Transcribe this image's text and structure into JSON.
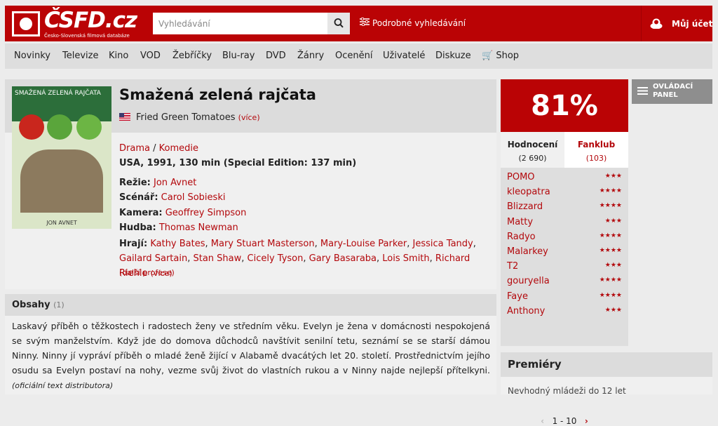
{
  "header": {
    "logo_text": "ČSFD.cz",
    "logo_tagline": "Česko-Slovenská filmová databáze",
    "search_placeholder": "Vyhledávání",
    "advanced_search": "Podrobné vyhledávání",
    "account": "Můj účet"
  },
  "nav": {
    "items": [
      "Novinky",
      "Televize",
      "Kino",
      "VOD",
      "Žebříčky",
      "Blu-ray",
      "DVD",
      "Žánry",
      "Ocenění",
      "Uživatelé",
      "Diskuze",
      "Shop"
    ]
  },
  "poster": {
    "title": "SMAŽENÁ ZELENÁ RAJČATA",
    "director": "JON AVNET"
  },
  "film": {
    "title": "Smažená zelená rajčata",
    "original_title": "Fried Green Tomatoes",
    "more": "(více)",
    "genres": [
      "Drama",
      "Komedie"
    ],
    "genre_sep": " / ",
    "origin": "USA, 1991, 130 min (Special Edition: 137 min)",
    "crew": [
      {
        "role": "Režie:",
        "name": "Jon Avnet"
      },
      {
        "role": "Scénář:",
        "name": "Carol Sobieski"
      },
      {
        "role": "Kamera:",
        "name": "Geoffrey Simpson"
      },
      {
        "role": "Hudba:",
        "name": "Thomas Newman"
      }
    ],
    "cast_label": "Hrají:",
    "cast": [
      "Kathy Bates",
      "Mary Stuart Masterson",
      "Mary-Louise Parker",
      "Jessica Tandy",
      "Gailard Sartain",
      "Stan Shaw",
      "Cicely Tyson",
      "Gary Basaraba",
      "Lois Smith",
      "Richard Riehle"
    ],
    "cast_more": "(více)",
    "more_professions": "(další profese)"
  },
  "plots": {
    "title": "Obsahy",
    "count": "(1)",
    "text": "Laskavý příběh o těžkostech i radostech ženy ve středním věku. Evelyn je žena v domácnosti nespokojená se svým manželstvím. Když jde do domova důchodců navštívit senilní tetu, seznámí se se starší dámou Ninny. Ninny jí vypráví příběh o mladé ženě žijící v Alabamě dvacátých let 20. století. Prostřednictvím jejího osudu sa Evelyn postaví na nohy, vezme svůj život do vlastních rukou a v Ninny najde nejlepší přítelkyni.",
    "source": "(oficiální text distributora)"
  },
  "rating": {
    "percent": "81%",
    "tab_ratings": "Hodnocení",
    "tab_ratings_count": "(2 690)",
    "tab_fanclub": "Fanklub",
    "tab_fanclub_count": "(103)",
    "users": [
      {
        "name": "POMO",
        "stars": 3
      },
      {
        "name": "kleopatra",
        "stars": 4
      },
      {
        "name": "Blizzard",
        "stars": 4
      },
      {
        "name": "Matty",
        "stars": 3
      },
      {
        "name": "Radyo",
        "stars": 4
      },
      {
        "name": "Malarkey",
        "stars": 4
      },
      {
        "name": "T2",
        "stars": 3
      },
      {
        "name": "gouryella",
        "stars": 4
      },
      {
        "name": "Faye",
        "stars": 4
      },
      {
        "name": "Anthony",
        "stars": 3
      }
    ],
    "pager": "1 - 10"
  },
  "panel_button": "OVLÁDACÍ PANEL",
  "premiery": {
    "title": "Premiéry",
    "subtitle": "Nevhodný mládeži do 12 let"
  }
}
